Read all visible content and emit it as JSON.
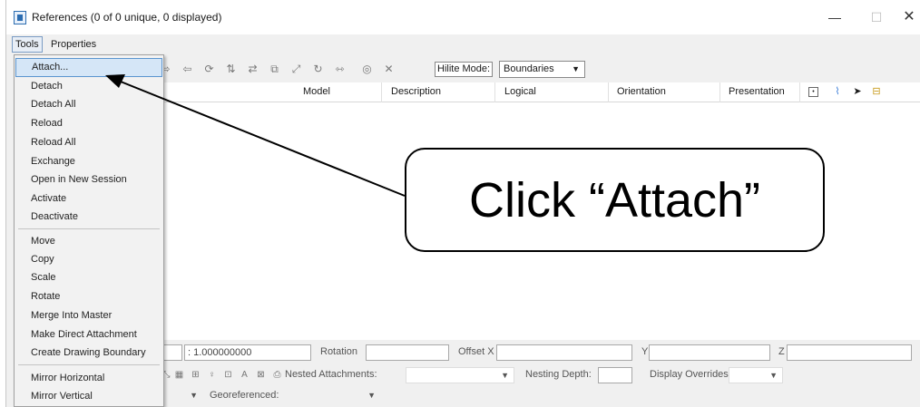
{
  "window": {
    "title": "References (0 of 0 unique, 0 displayed)",
    "minimize_glyph": "—",
    "maximize_glyph": "☐",
    "close_glyph": "✕"
  },
  "menubar": {
    "tools": "Tools",
    "properties": "Properties"
  },
  "toolbar": {
    "hilite_label": "Hilite Mode:",
    "hilite_value": "Boundaries"
  },
  "columns": [
    "Model",
    "Description",
    "Logical",
    "Orientation",
    "Presentation"
  ],
  "settings": {
    "scale_value": ": 1.000000000",
    "rotation_label": "Rotation",
    "offset_x_label": "Offset X",
    "y_label": "Y",
    "z_label": "Z",
    "nested_label": "Nested Attachments:",
    "nesting_label": "Nesting Depth:",
    "overrides_label": "Display Overrides:",
    "geo_label": "Georeferenced:"
  },
  "tools_menu": {
    "items": [
      "Attach...",
      "Detach",
      "Detach All",
      "Reload",
      "Reload All",
      "Exchange",
      "Open in New Session",
      "Activate",
      "Deactivate",
      "Move",
      "Copy",
      "Scale",
      "Rotate",
      "Merge Into Master",
      "Make Direct Attachment",
      "Create Drawing Boundary",
      "Mirror Horizontal",
      "Mirror Vertical"
    ]
  },
  "annotation": {
    "callout_text": "Click “Attach”"
  },
  "colors": {
    "menu_highlight": "#d5e6f7",
    "menu_highlight_border": "#5b95cf",
    "window_bg": "#f0f0f0"
  }
}
